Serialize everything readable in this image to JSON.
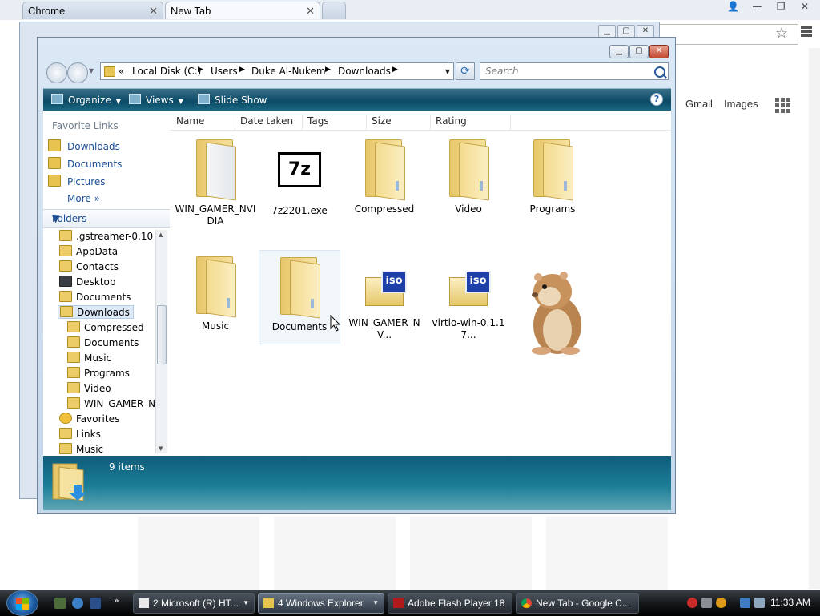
{
  "chrome": {
    "tabs": [
      {
        "label": "Chrome"
      },
      {
        "label": "New Tab"
      }
    ],
    "links": {
      "gmail": "Gmail",
      "images": "Images"
    }
  },
  "explorer": {
    "address": {
      "prefix": "«",
      "crumbs": [
        "Local Disk (C:)",
        "Users",
        "Duke Al-Nukem",
        "Downloads"
      ]
    },
    "search": {
      "placeholder": "Search"
    },
    "commands": {
      "organize": "Organize",
      "views": "Views",
      "slideshow": "Slide Show"
    },
    "favorites": {
      "heading": "Favorite Links",
      "items": [
        "Downloads",
        "Documents",
        "Pictures"
      ],
      "more": "More"
    },
    "folders": {
      "heading": "Folders",
      "tree": [
        {
          "label": ".gstreamer-0.10"
        },
        {
          "label": "AppData"
        },
        {
          "label": "Contacts"
        },
        {
          "label": "Desktop"
        },
        {
          "label": "Documents"
        },
        {
          "label": "Downloads",
          "selected": true
        },
        {
          "label": "Compressed"
        },
        {
          "label": "Documents"
        },
        {
          "label": "Music"
        },
        {
          "label": "Programs"
        },
        {
          "label": "Video"
        },
        {
          "label": "WIN_GAMER_NV"
        },
        {
          "label": "Favorites"
        },
        {
          "label": "Links"
        },
        {
          "label": "Music"
        }
      ]
    },
    "columns": [
      "Name",
      "Date taken",
      "Tags",
      "Size",
      "Rating"
    ],
    "files": [
      {
        "name": "WIN_GAMER_NVIDIA",
        "icon": "folder-with-documents-icon"
      },
      {
        "name": "7z2201.exe",
        "icon": "7z-icon"
      },
      {
        "name": "Compressed",
        "icon": "folder-icon"
      },
      {
        "name": "Video",
        "icon": "folder-icon"
      },
      {
        "name": "Programs",
        "icon": "folder-icon"
      },
      {
        "name": "Music",
        "icon": "folder-icon"
      },
      {
        "name": "Documents",
        "icon": "folder-icon"
      },
      {
        "name": "WIN_GAMER_NV...",
        "icon": "iso-icon"
      },
      {
        "name": "virtio-win-0.1.17...",
        "icon": "iso-icon"
      },
      {
        "name": "",
        "icon": "hamster-image"
      }
    ],
    "details": {
      "count": "9 items"
    }
  },
  "taskbar": {
    "tasks": [
      {
        "label": "2 Microsoft (R) HT..."
      },
      {
        "label": "4 Windows Explorer"
      },
      {
        "label": "Adobe Flash Player 18"
      },
      {
        "label": "New Tab - Google C..."
      }
    ],
    "clock": "11:33 AM"
  },
  "colors": {
    "accent": "#1c4d94",
    "cmdbar": "#0b4a66",
    "folder": "#f3db8e"
  }
}
